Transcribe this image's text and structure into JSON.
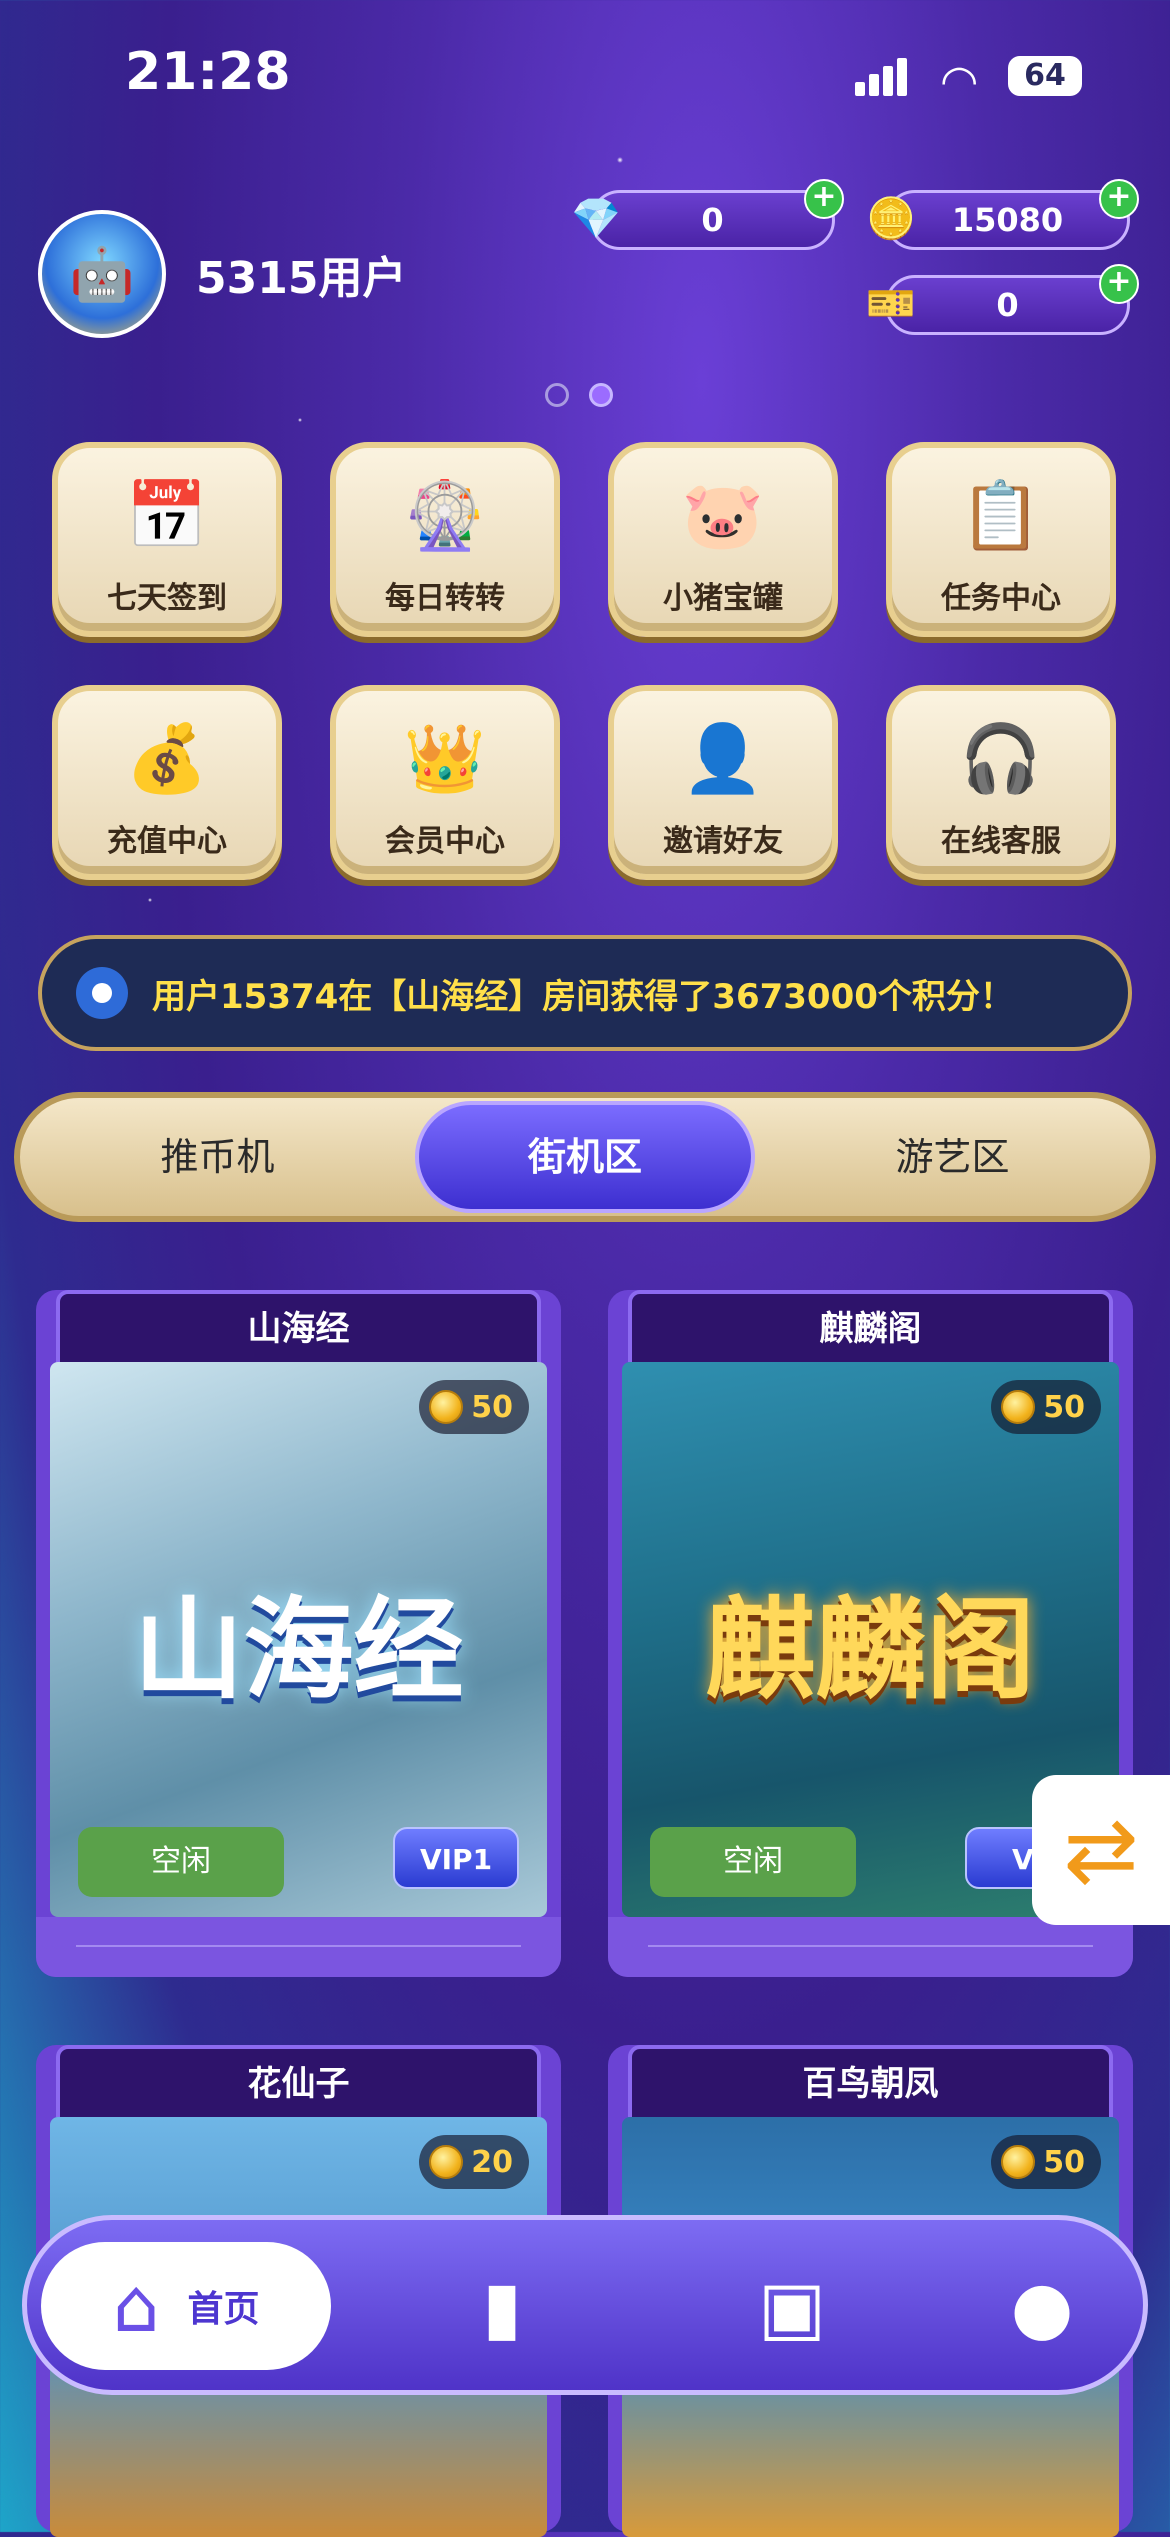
{
  "status_bar": {
    "time": "21:28",
    "battery": "64"
  },
  "profile": {
    "username": "5315用户"
  },
  "currencies": {
    "diamonds": "0",
    "coins": "15080",
    "tickets": "0"
  },
  "quick_actions": [
    {
      "label": "七天签到",
      "icon": "calendar-7-icon"
    },
    {
      "label": "每日转转",
      "icon": "wheel-icon"
    },
    {
      "label": "小猪宝罐",
      "icon": "piggy-bank-icon"
    },
    {
      "label": "任务中心",
      "icon": "clipboard-icon"
    },
    {
      "label": "充值中心",
      "icon": "wallet-coins-icon"
    },
    {
      "label": "会员中心",
      "icon": "crown-icon"
    },
    {
      "label": "邀请好友",
      "icon": "add-user-icon"
    },
    {
      "label": "在线客服",
      "icon": "headset-icon"
    }
  ],
  "ticker": {
    "message": "用户15374在【山海经】房间获得了3673000个积分！"
  },
  "tabs": [
    "推币机",
    "街机区",
    "游艺区"
  ],
  "active_tab": "街机区",
  "games": [
    {
      "title": "山海经",
      "cost": "50",
      "art_text": "山海经",
      "status": "空闲",
      "vip": "VIP1"
    },
    {
      "title": "麒麟阁",
      "cost": "50",
      "art_text": "麒麟阁",
      "status": "空闲",
      "vip": "VI"
    },
    {
      "title": "花仙子",
      "cost": "20",
      "art_text": ""
    },
    {
      "title": "百鸟朝凤",
      "cost": "50",
      "art_text": ""
    }
  ],
  "bottom_nav": {
    "home_label": "首页"
  },
  "colors": {
    "accent": "#4d36d0",
    "gold": "#e8cf8f",
    "ticker_text": "#ffe04a"
  }
}
